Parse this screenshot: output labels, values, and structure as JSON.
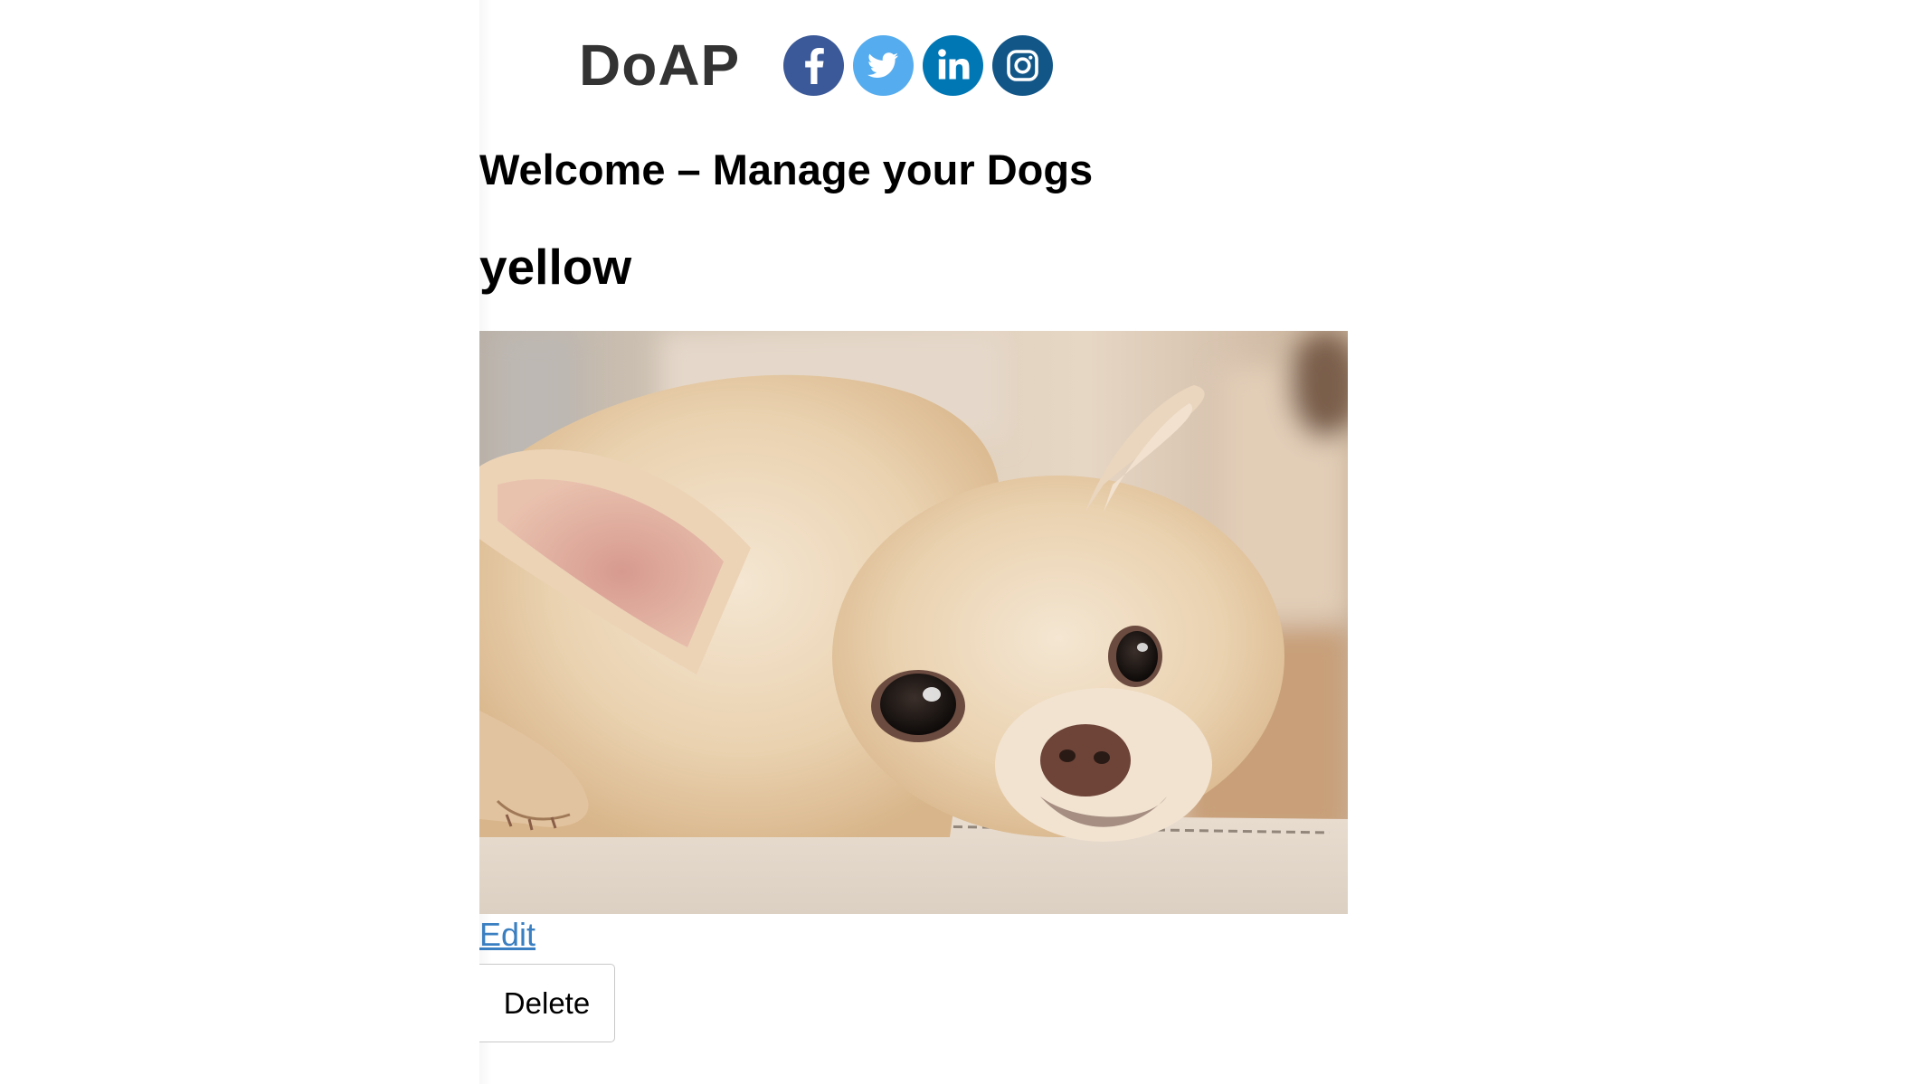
{
  "header": {
    "brand": "DoAP",
    "social": [
      {
        "name": "facebook",
        "icon": "facebook-icon",
        "color": "#3b5998"
      },
      {
        "name": "twitter",
        "icon": "twitter-icon",
        "color": "#55acee"
      },
      {
        "name": "linkedin",
        "icon": "linkedin-icon",
        "color": "#0077b5"
      },
      {
        "name": "instagram",
        "icon": "instagram-icon",
        "color": "#125688"
      }
    ]
  },
  "main": {
    "welcome_title": "Welcome – Manage your Dogs",
    "dog": {
      "name": "yellow",
      "photo": "chihuahua-photo",
      "edit_label": "Edit",
      "delete_label": "Delete"
    }
  },
  "colors": {
    "link": "#3a7fc1",
    "brand_text": "#333333"
  }
}
